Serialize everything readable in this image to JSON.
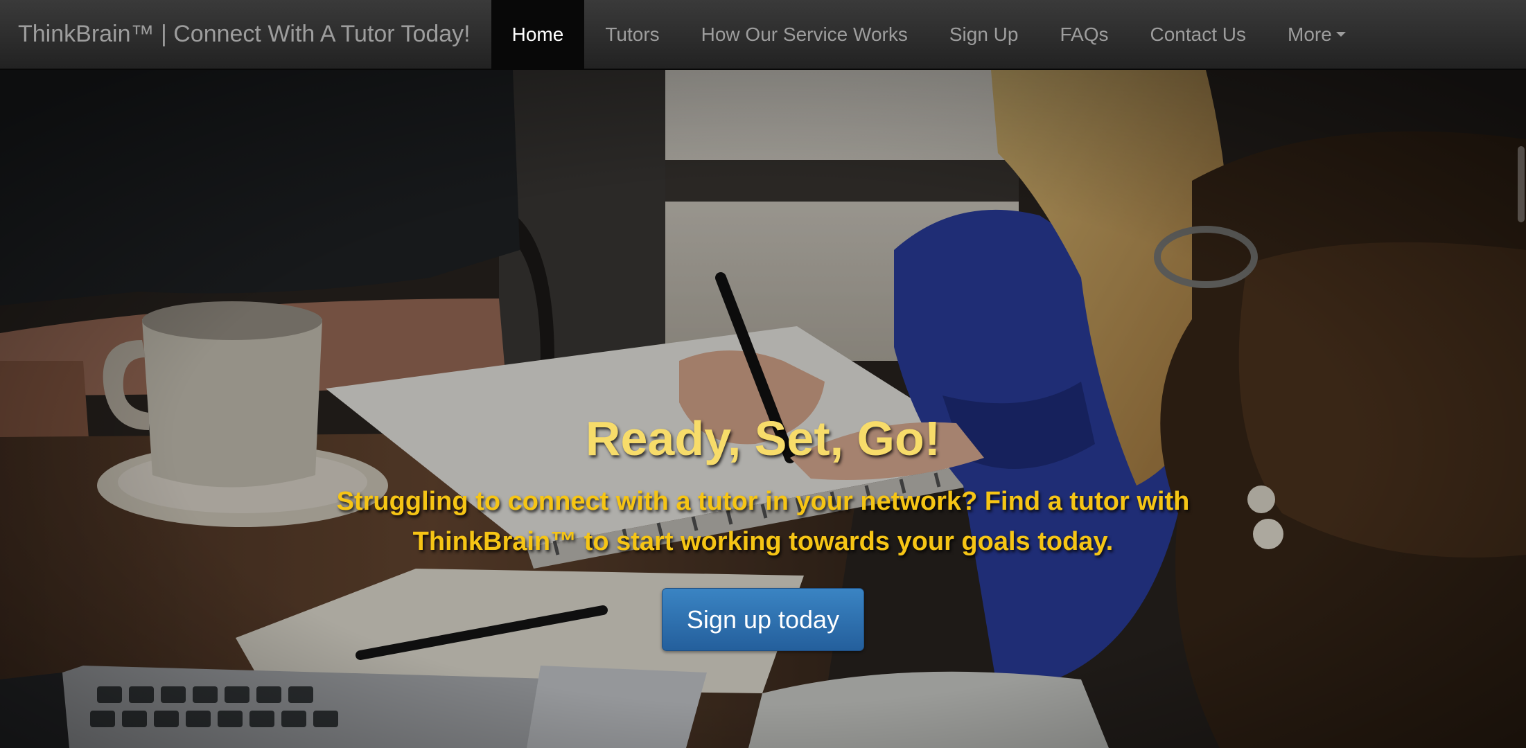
{
  "navbar": {
    "brand": "ThinkBrain™ | Connect With A Tutor Today!",
    "items": [
      {
        "label": "Home",
        "active": true
      },
      {
        "label": "Tutors"
      },
      {
        "label": "How Our Service Works"
      },
      {
        "label": "Sign Up"
      },
      {
        "label": "FAQs"
      },
      {
        "label": "Contact Us"
      },
      {
        "label": "More",
        "icon": "caret-down-icon"
      }
    ]
  },
  "hero": {
    "title": "Ready, Set, Go!",
    "subtitle": "Struggling to connect with a tutor in your network? Find a tutor with ThinkBrain™ to start working towards your goals today.",
    "cta_label": "Sign up today"
  },
  "colors": {
    "title": "#f7dc6a",
    "subtitle": "#f6c515",
    "cta": "#2d6faf",
    "nav_active_bg": "#080808"
  }
}
